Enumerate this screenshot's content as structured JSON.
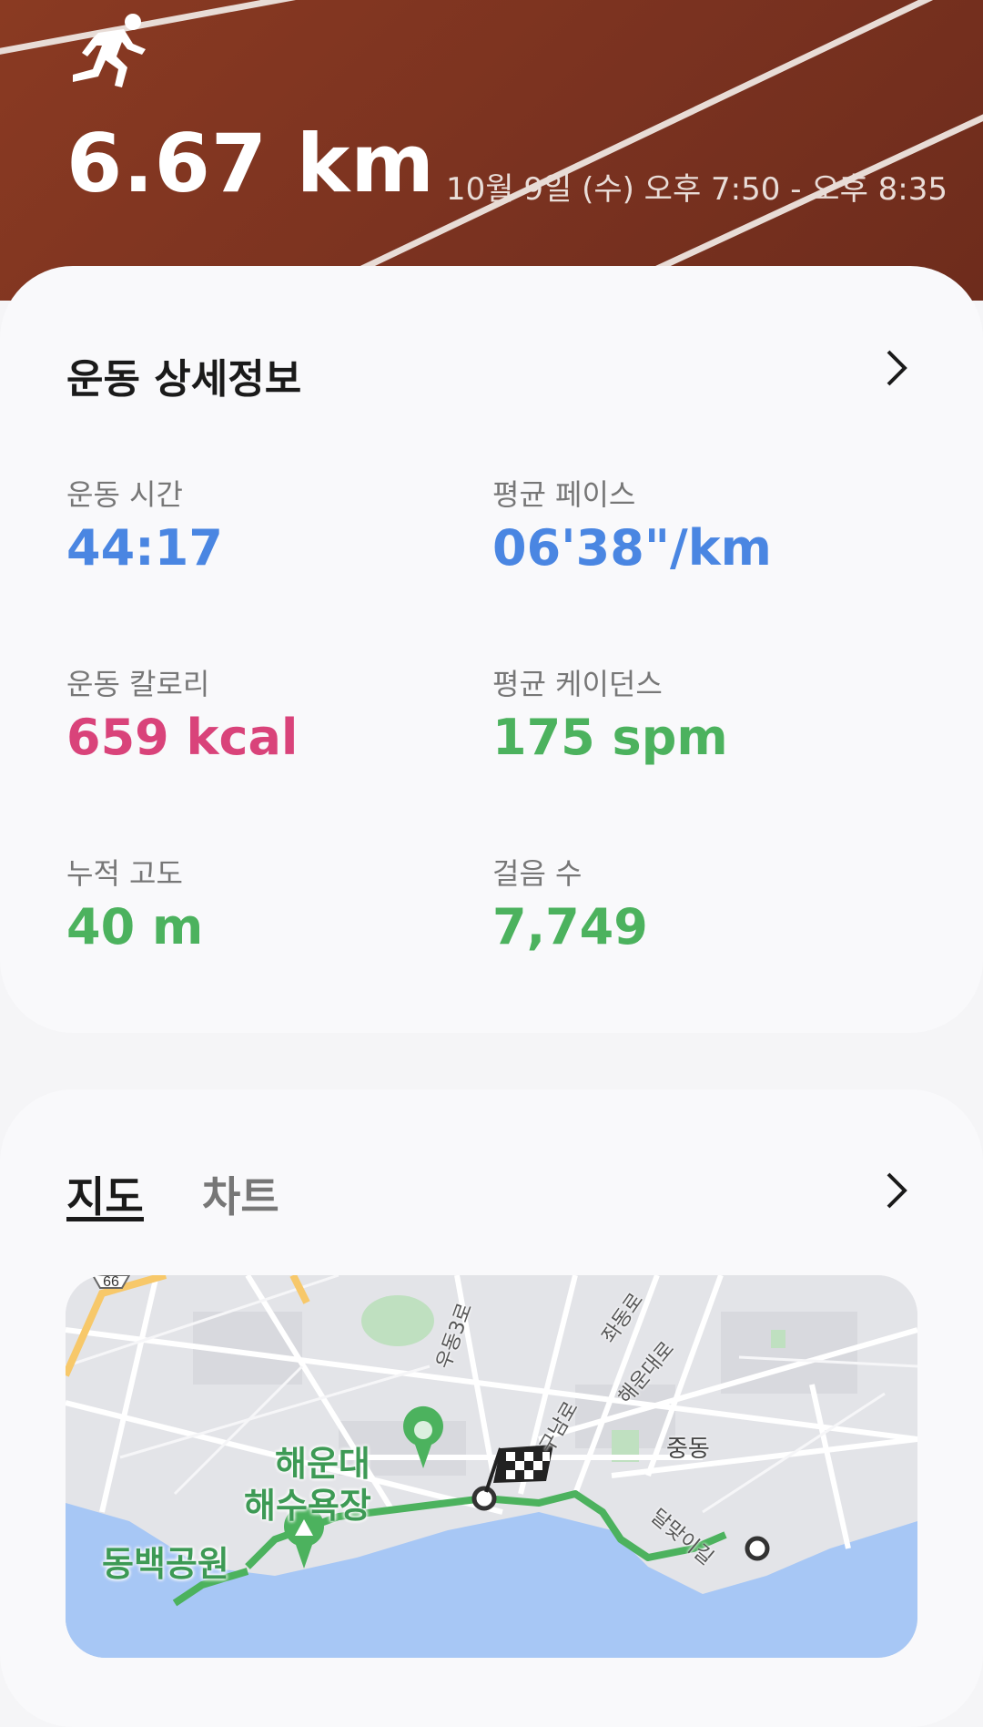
{
  "header": {
    "activity_icon": "running-person-icon",
    "distance": "6.67 km",
    "date_range": "10월 9일 (수) 오후 7:50 - 오후 8:35"
  },
  "details": {
    "title": "운동 상세정보",
    "stats": [
      {
        "label": "운동 시간",
        "value": "44:17",
        "unit": "",
        "color": "#4a86e2"
      },
      {
        "label": "평균 페이스",
        "value": "06'38\"",
        "unit": "/km",
        "color": "#4a86e2"
      },
      {
        "label": "운동 칼로리",
        "value": "659",
        "unit": "kcal",
        "color": "#d9437a"
      },
      {
        "label": "평균 케이던스",
        "value": "175",
        "unit": "spm",
        "color": "#4cb25e"
      },
      {
        "label": "누적 고도",
        "value": "40",
        "unit": "m",
        "color": "#4cb25e"
      },
      {
        "label": "걸음 수",
        "value": "7,749",
        "unit": "",
        "color": "#4cb25e"
      }
    ]
  },
  "map_section": {
    "tabs": [
      {
        "label": "지도",
        "active": true
      },
      {
        "label": "차트",
        "active": false
      }
    ],
    "road_badge": "66",
    "places": {
      "beach_line1": "해운대",
      "beach_line2": "해수욕장",
      "park": "동백공원",
      "district": "중동"
    },
    "streets": {
      "s1": "우동3로",
      "s2": "좌동로",
      "s3": "해운대로",
      "s4": "구남로",
      "s5": "달맞이길"
    },
    "route_color": "#4cb25e"
  }
}
